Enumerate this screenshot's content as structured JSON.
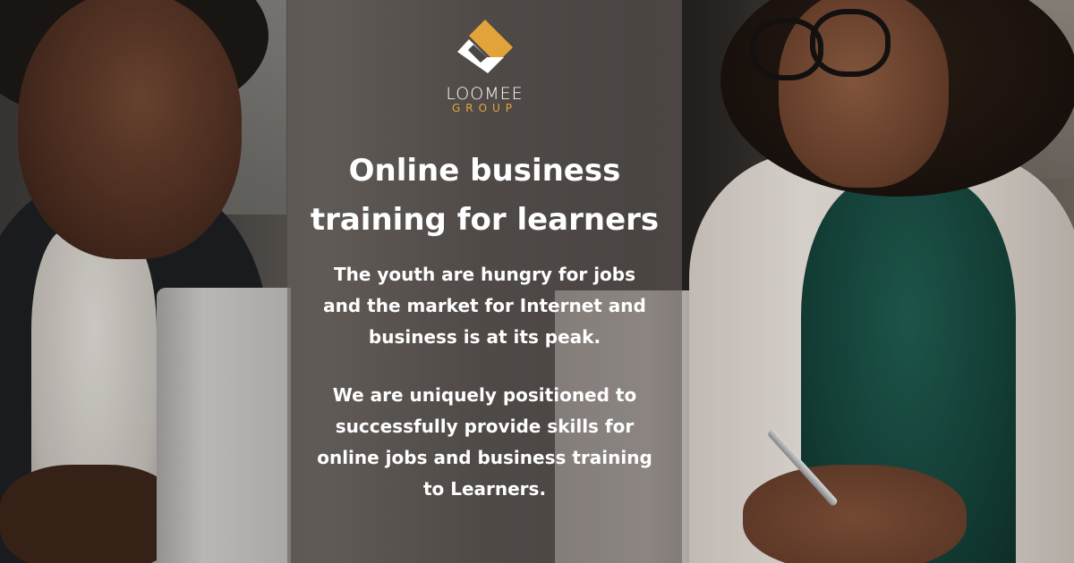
{
  "brand": {
    "name": "LOOMEE",
    "sub": "GROUP",
    "accent_color": "#e2a43a",
    "logo_icon": "diamond-l-logo-icon"
  },
  "headline": {
    "line1": "Online business",
    "line2": "training for learners"
  },
  "paragraph1": {
    "line1": "The youth are hungry for jobs",
    "line2": "and the market for Internet and",
    "line3": "business is at its peak."
  },
  "paragraph2": {
    "line1": "We are uniquely positioned to",
    "line2": "successfully provide skills for",
    "line3": "online jobs and business training",
    "line4": "to Learners."
  }
}
